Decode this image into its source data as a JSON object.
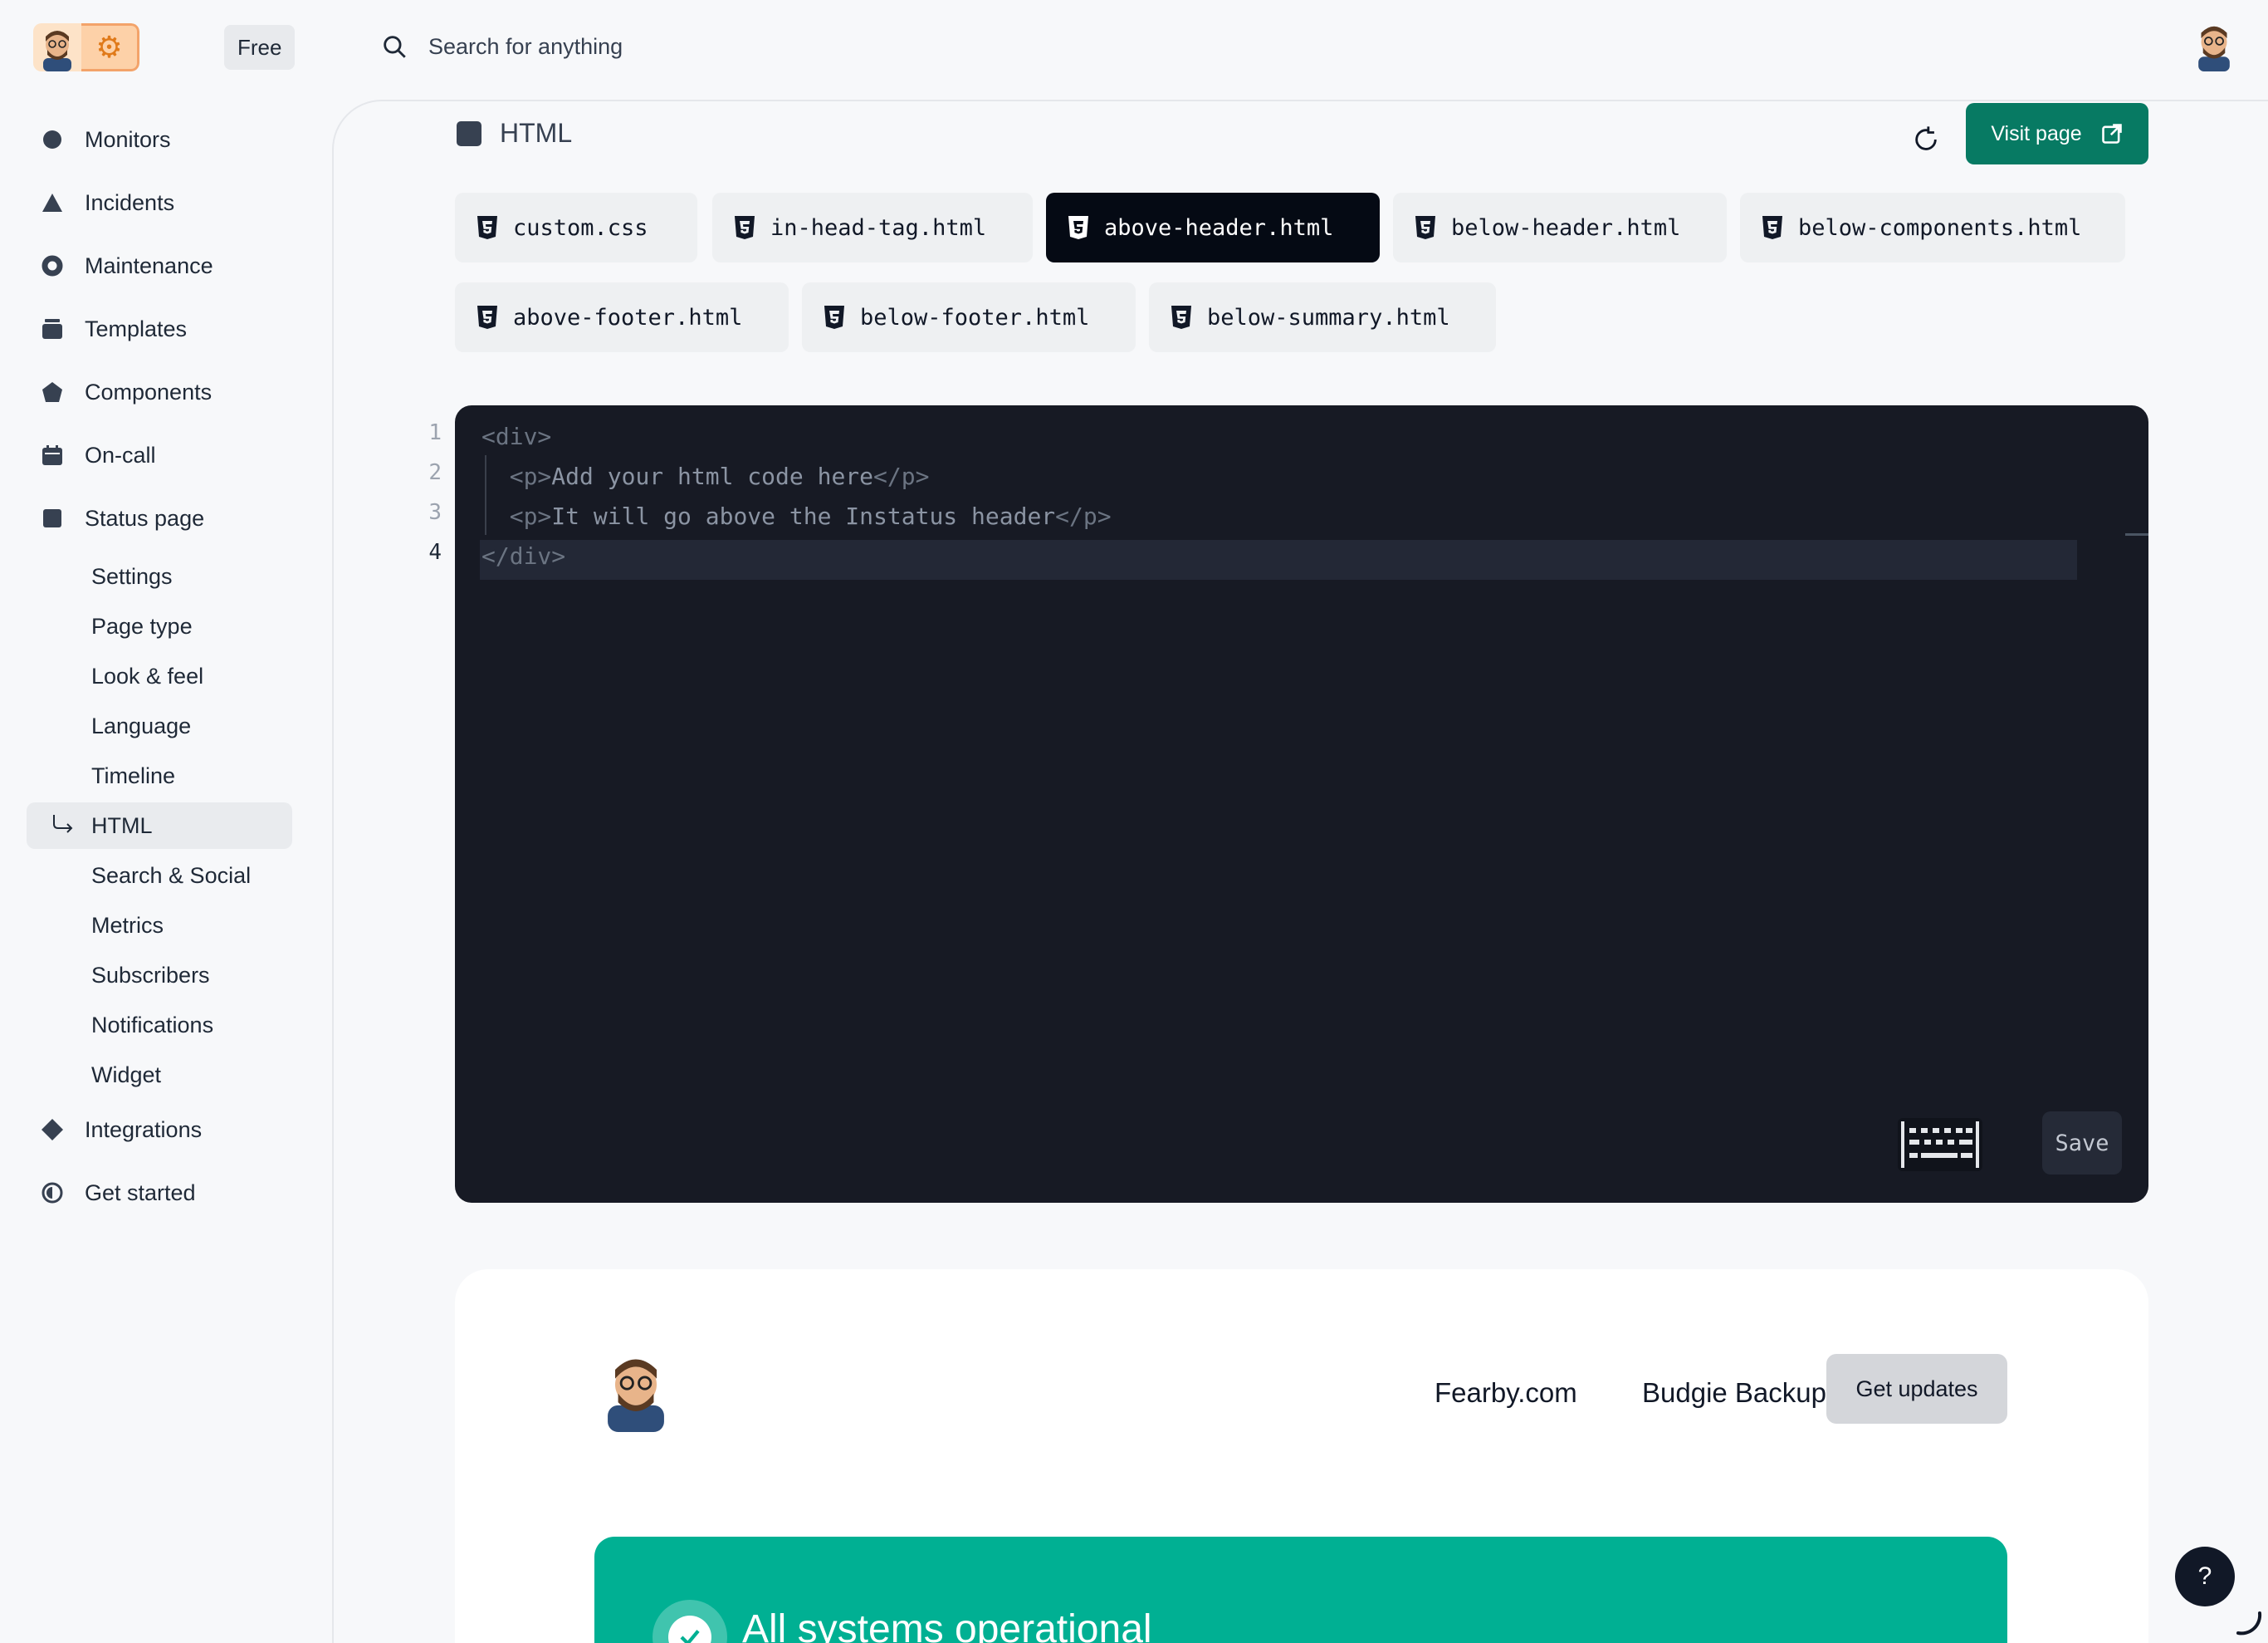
{
  "app": {
    "plan_badge": "Free",
    "search_placeholder": "Search for anything"
  },
  "sidebar": {
    "items": [
      {
        "label": "Monitors",
        "icon": "circle-icon"
      },
      {
        "label": "Incidents",
        "icon": "triangle-icon"
      },
      {
        "label": "Maintenance",
        "icon": "ring-icon"
      },
      {
        "label": "Templates",
        "icon": "stack-icon"
      },
      {
        "label": "Components",
        "icon": "pentagon-icon"
      },
      {
        "label": "On-call",
        "icon": "calendar-icon"
      },
      {
        "label": "Status page",
        "icon": "square-icon"
      }
    ],
    "status_page_sub": [
      "Settings",
      "Page type",
      "Look & feel",
      "Language",
      "Timeline",
      "HTML",
      "Search & Social",
      "Metrics",
      "Subscribers",
      "Notifications",
      "Widget"
    ],
    "active_sub": "HTML",
    "bottom_items": [
      {
        "label": "Integrations",
        "icon": "diamond-icon"
      },
      {
        "label": "Get started",
        "icon": "half-circle-icon"
      }
    ]
  },
  "main": {
    "title": "HTML",
    "visit_label": "Visit page",
    "tabs": [
      "custom.css",
      "in-head-tag.html",
      "above-header.html",
      "below-header.html",
      "below-components.html",
      "above-footer.html",
      "below-footer.html",
      "below-summary.html"
    ],
    "active_tab": "above-header.html",
    "editor": {
      "line_numbers": [
        "1",
        "2",
        "3",
        "4"
      ],
      "lines": [
        {
          "open": "<div>",
          "text": "",
          "close": ""
        },
        {
          "open": "  <p>",
          "text": "Add your html code here",
          "close": "</p>"
        },
        {
          "open": "  <p>",
          "text": "It will go above the Instatus header",
          "close": "</p>"
        },
        {
          "open": "</div>",
          "text": "",
          "close": ""
        }
      ],
      "current_line": 4,
      "save_label": "Save"
    }
  },
  "preview": {
    "links": [
      "Fearby.com",
      "Budgie Backup"
    ],
    "updates_button": "Get updates",
    "status_text": "All systems operational",
    "status_color": "#00b093"
  },
  "help": {
    "label": "?"
  },
  "colors": {
    "accent": "#077a63",
    "active_tab": "#050a14",
    "editor_bg": "#171a24"
  }
}
